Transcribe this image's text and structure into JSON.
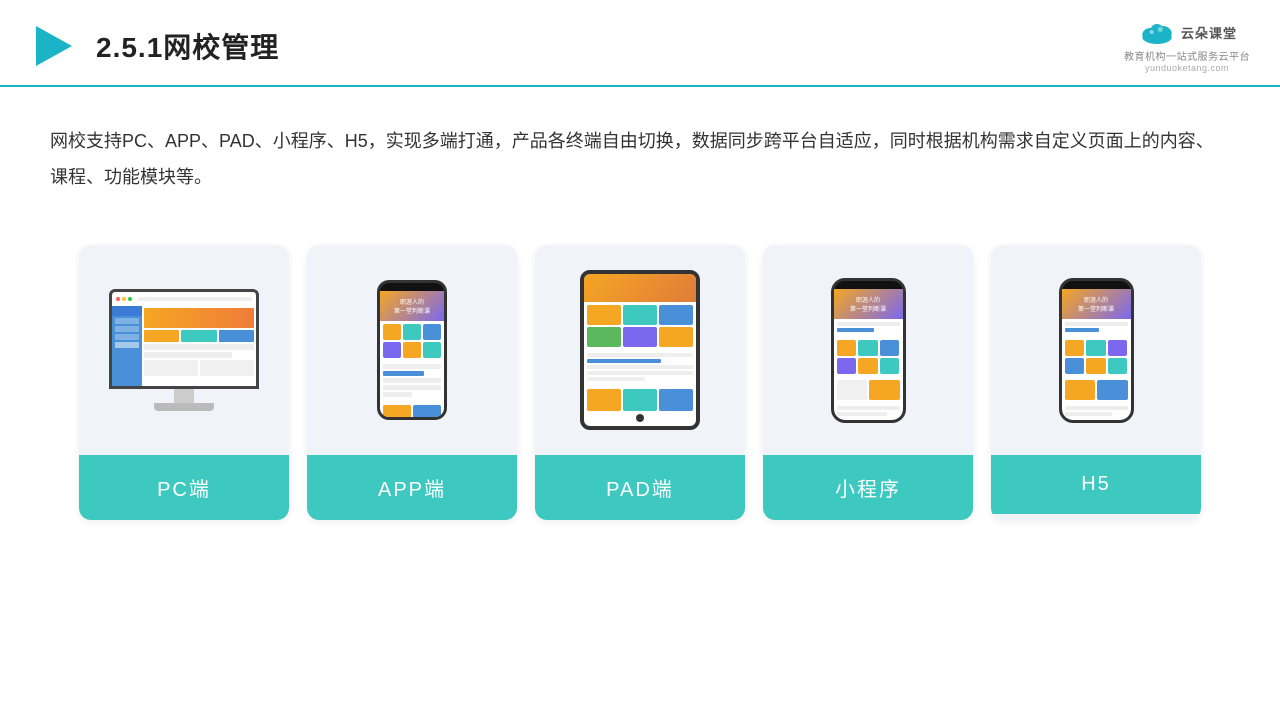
{
  "header": {
    "title": "2.5.1网校管理",
    "logo_name": "云朵课堂",
    "logo_domain": "yunduoketang.com",
    "logo_tagline": "教育机构一站式服务云平台"
  },
  "description": {
    "text": "网校支持PC、APP、PAD、小程序、H5，实现多端打通，产品各终端自由切换，数据同步跨平台自适应，同时根据机构需求自定义页面上的内容、课程、功能模块等。"
  },
  "cards": [
    {
      "id": "pc",
      "label": "PC端"
    },
    {
      "id": "app",
      "label": "APP端"
    },
    {
      "id": "pad",
      "label": "PAD端"
    },
    {
      "id": "miniprogram",
      "label": "小程序"
    },
    {
      "id": "h5",
      "label": "H5"
    }
  ]
}
